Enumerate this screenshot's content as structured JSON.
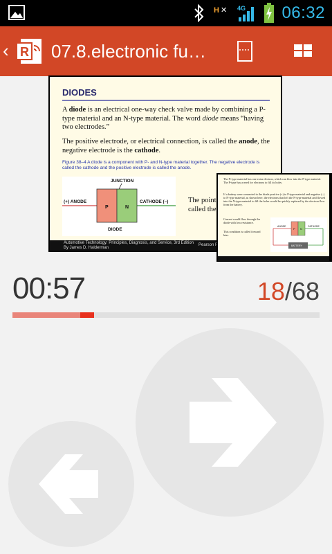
{
  "status_bar": {
    "time": "06:32",
    "icons": [
      "gallery-icon",
      "bluetooth-icon",
      "vibrate-off-icon",
      "signal-4g-icon",
      "battery-charging-icon"
    ]
  },
  "app_bar": {
    "back_icon": "chevron-left-icon",
    "logo_icon": "powerpoint-broadcast-icon",
    "title": "07.8.electronic fu…",
    "actions": [
      "notes-icon",
      "slide-grid-icon"
    ],
    "color": "#d24726"
  },
  "current_slide": {
    "heading": "DIODES",
    "para1_a": "A ",
    "para1_b": "diode",
    "para1_c": " is an electrical one-way check valve made by combining a P-type material and an N-type material. The word ",
    "para1_d": "diode",
    "para1_e": " means “having two electrodes.”",
    "para2_a": "The positive electrode, or electrical connection, is called the ",
    "para2_b": "anode",
    "para2_c": ", the negative electrode is the ",
    "para2_d": "cathode",
    "para2_e": ".",
    "caption": "Figure 38–4  A diode is a component with P- and N-type material together. The negative electrode is called the cathode and the positive electrode is called the anode.",
    "diagram": {
      "junction": "JUNCTION",
      "anode": "(+) ANODE",
      "cathode": "CATHODE (–)",
      "p": "P",
      "n": "N",
      "label": "DIODE"
    },
    "side_text": "The point… types of m… called the…",
    "footer_book": "Automotive Technology: Principles, Diagnosis, and Service, 3rd Edition",
    "footer_author": "By James D. Halderman",
    "footer_publisher": "Pearson Pr…"
  },
  "next_slide": {
    "p1": "The N-type material has one extra electron, which can flow into the P-type material. The P-type has a need for electrons to fill its holes.",
    "p2": "If a battery were connected to the diode positive (+) to P-type material and negative (–) to N-type material, as shown here, the electrons that left the N-type material and flowed into the N-type material to fill the holes would be quickly replaced by the electron flow from the battery.",
    "p3": "Current would flow through the diode with low resistance.",
    "p4": "This condition is called forward bias.",
    "diagram_labels": {
      "anode": "ANODE",
      "cathode": "CATHODE",
      "battery": "BATTERY",
      "p": "P",
      "n": "N"
    }
  },
  "presentation": {
    "timer": "00:57",
    "current_slide": "18",
    "separator": "/",
    "total_slides": "68",
    "progress_fraction": 0.2647
  },
  "navigation": {
    "next_icon": "arrow-right-icon",
    "prev_icon": "arrow-left-icon"
  }
}
